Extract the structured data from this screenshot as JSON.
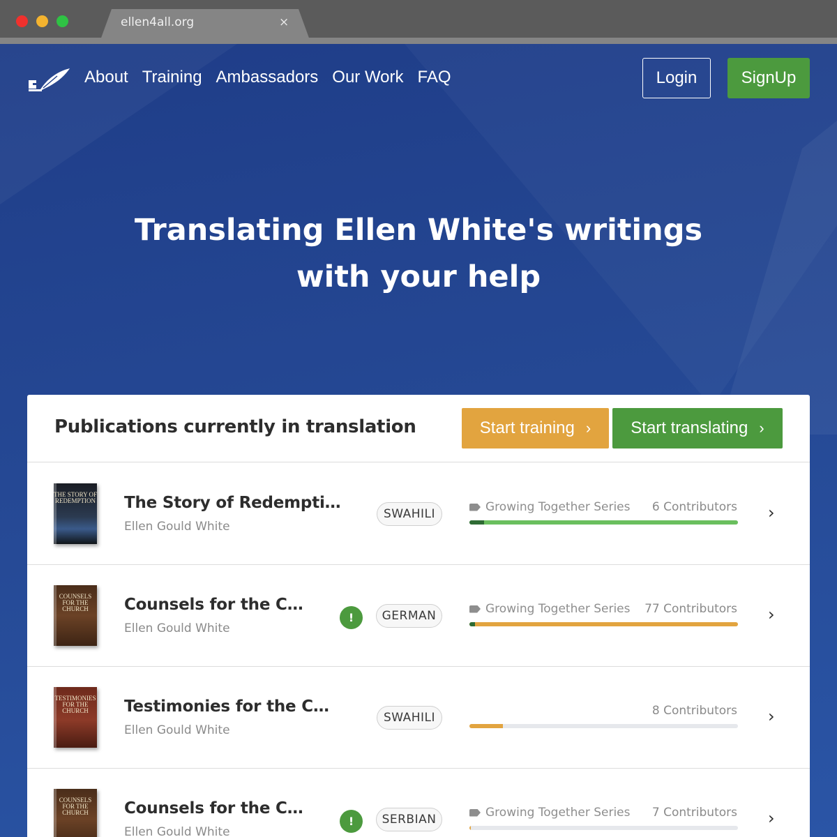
{
  "browser": {
    "tab_title": "ellen4all.org",
    "tab_close": "×"
  },
  "nav": {
    "logo": "ellen4all-quill-logo",
    "links": [
      "About",
      "Training",
      "Ambassadors",
      "Our Work",
      "FAQ"
    ],
    "login_label": "Login",
    "signup_label": "SignUp"
  },
  "hero": {
    "title_line1": "Translating Ellen White's writings",
    "title_line2": "with your help"
  },
  "publications": {
    "heading": "Publications currently in translation",
    "start_training_label": "Start training",
    "start_translating_label": "Start translating",
    "chevron": "›",
    "items": [
      {
        "title": "The Story of Redemption",
        "author": "Ellen Gould White",
        "cover_text": "The Story of Redemption",
        "language": "SWAHILI",
        "series": "Growing Together Series",
        "contributors": "6 Contributors",
        "alert": "",
        "progress": 1.0,
        "progress_done": 0.055,
        "progress_color": "#6abf5e"
      },
      {
        "title": "Counsels for the Church",
        "author": "Ellen Gould White",
        "cover_text": "Counsels for the Church",
        "language": "GERMAN",
        "series": "Growing Together Series",
        "contributors": "77 Contributors",
        "alert": "!",
        "progress": 1.0,
        "progress_done": 0.02,
        "progress_color": "#e2a43f"
      },
      {
        "title": "Testimonies for the Church",
        "author": "Ellen Gould White",
        "cover_text": "Testimonies for the Church",
        "language": "SWAHILI",
        "series": "",
        "contributors": "8 Contributors",
        "alert": "",
        "progress": 0.125,
        "progress_done": 0,
        "progress_color": "#e2a43f"
      },
      {
        "title": "Counsels for the Church",
        "author": "Ellen Gould White",
        "cover_text": "Counsels for the Church",
        "language": "SERBIAN",
        "series": "Growing Together Series",
        "contributors": "7 Contributors",
        "alert": "!",
        "progress": 0.006,
        "progress_done": 0,
        "progress_color": "#e2a43f"
      }
    ]
  }
}
